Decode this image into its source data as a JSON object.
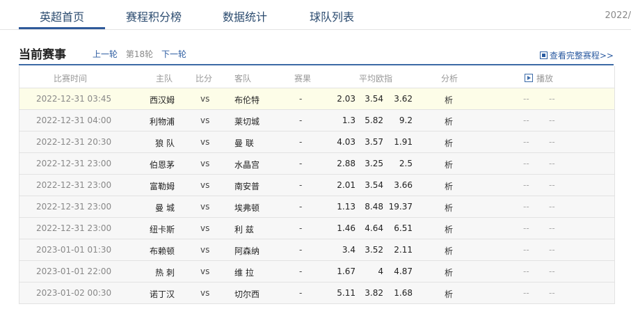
{
  "nav": {
    "tabs": [
      {
        "label": "英超首页"
      },
      {
        "label": "赛程积分榜"
      },
      {
        "label": "数据统计"
      },
      {
        "label": "球队列表"
      }
    ],
    "date_corner": "2022/"
  },
  "section": {
    "title": "当前赛事",
    "prev_round": "上一轮",
    "current_round": "第18轮",
    "next_round": "下一轮",
    "full_schedule": "查看完整赛程>>"
  },
  "table": {
    "headers": {
      "time": "比赛时间",
      "home": "主队",
      "score": "比分",
      "away": "客队",
      "result": "赛果",
      "odds": "平均欧指",
      "analysis": "分析",
      "broadcast": "播放"
    },
    "rows": [
      {
        "time": "2022-12-31 03:45",
        "home": "西汉姆",
        "vs": "vs",
        "away": "布伦特",
        "result": "-",
        "o1": "2.03",
        "o2": "3.54",
        "o3": "3.62",
        "analysis": "析",
        "b1": "--",
        "b2": "--"
      },
      {
        "time": "2022-12-31 04:00",
        "home": "利物浦",
        "vs": "vs",
        "away": "莱切城",
        "result": "-",
        "o1": "1.3",
        "o2": "5.82",
        "o3": "9.2",
        "analysis": "析",
        "b1": "--",
        "b2": "--"
      },
      {
        "time": "2022-12-31 20:30",
        "home": "狼 队",
        "vs": "vs",
        "away": "曼 联",
        "result": "-",
        "o1": "4.03",
        "o2": "3.57",
        "o3": "1.91",
        "analysis": "析",
        "b1": "--",
        "b2": "--"
      },
      {
        "time": "2022-12-31 23:00",
        "home": "伯恩茅",
        "vs": "vs",
        "away": "水晶宫",
        "result": "-",
        "o1": "2.88",
        "o2": "3.25",
        "o3": "2.5",
        "analysis": "析",
        "b1": "--",
        "b2": "--"
      },
      {
        "time": "2022-12-31 23:00",
        "home": "富勒姆",
        "vs": "vs",
        "away": "南安普",
        "result": "-",
        "o1": "2.01",
        "o2": "3.54",
        "o3": "3.66",
        "analysis": "析",
        "b1": "--",
        "b2": "--"
      },
      {
        "time": "2022-12-31 23:00",
        "home": "曼 城",
        "vs": "vs",
        "away": "埃弗顿",
        "result": "-",
        "o1": "1.13",
        "o2": "8.48",
        "o3": "19.37",
        "analysis": "析",
        "b1": "--",
        "b2": "--"
      },
      {
        "time": "2022-12-31 23:00",
        "home": "纽卡斯",
        "vs": "vs",
        "away": "利 兹",
        "result": "-",
        "o1": "1.46",
        "o2": "4.64",
        "o3": "6.51",
        "analysis": "析",
        "b1": "--",
        "b2": "--"
      },
      {
        "time": "2023-01-01 01:30",
        "home": "布赖顿",
        "vs": "vs",
        "away": "阿森纳",
        "result": "-",
        "o1": "3.4",
        "o2": "3.52",
        "o3": "2.11",
        "analysis": "析",
        "b1": "--",
        "b2": "--"
      },
      {
        "time": "2023-01-01 22:00",
        "home": "热 刺",
        "vs": "vs",
        "away": "维 拉",
        "result": "-",
        "o1": "1.67",
        "o2": "4",
        "o3": "4.87",
        "analysis": "析",
        "b1": "--",
        "b2": "--"
      },
      {
        "time": "2023-01-02 00:30",
        "home": "诺丁汉",
        "vs": "vs",
        "away": "切尔西",
        "result": "-",
        "o1": "5.11",
        "o2": "3.82",
        "o3": "1.68",
        "analysis": "析",
        "b1": "--",
        "b2": "--"
      }
    ]
  }
}
